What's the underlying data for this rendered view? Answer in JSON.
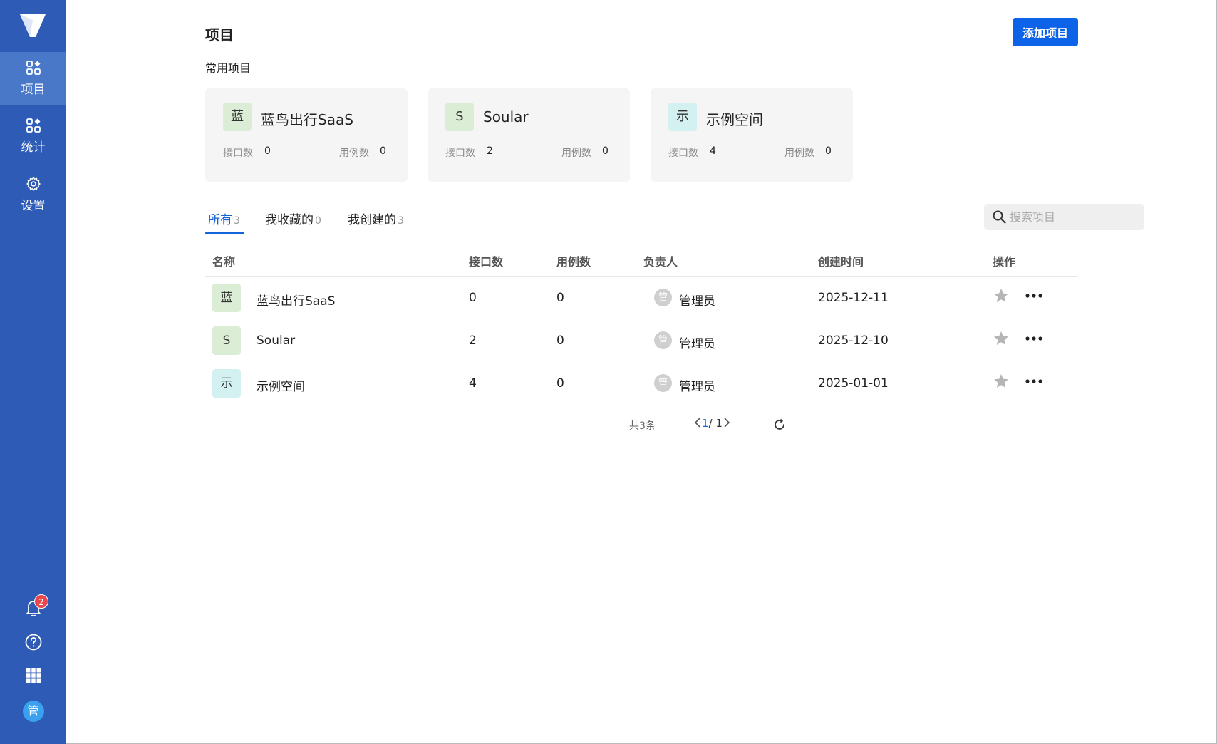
{
  "sidebar": {
    "nav": [
      {
        "label": "项目",
        "icon": "grid-icon",
        "active": true
      },
      {
        "label": "统计",
        "icon": "grid-icon",
        "active": false
      },
      {
        "label": "设置",
        "icon": "gear-icon",
        "active": false
      }
    ],
    "notifications_count": "2",
    "user_avatar_text": "管"
  },
  "header": {
    "title": "项目",
    "add_button": "添加项目"
  },
  "favorites": {
    "label": "常用项目",
    "cards": [
      {
        "mark": "蓝",
        "name": "蓝鸟出行SaaS",
        "api_label": "接口数",
        "api": "0",
        "case_label": "用例数",
        "cases": "0"
      },
      {
        "mark": "S",
        "name": "Soular",
        "api_label": "接口数",
        "api": "2",
        "case_label": "用例数",
        "cases": "0"
      },
      {
        "mark": "示",
        "name": "示例空间",
        "api_label": "接口数",
        "api": "4",
        "case_label": "用例数",
        "cases": "0"
      }
    ]
  },
  "tabs": [
    {
      "label": "所有",
      "count": "3"
    },
    {
      "label": "我收藏的",
      "count": "0"
    },
    {
      "label": "我创建的",
      "count": "3"
    }
  ],
  "search": {
    "placeholder": "搜索项目"
  },
  "table": {
    "columns": [
      "名称",
      "接口数",
      "用例数",
      "负责人",
      "创建时间",
      "操作"
    ],
    "rows": [
      {
        "mark": "蓝",
        "name": "蓝鸟出行SaaS",
        "api": "0",
        "cases": "0",
        "owner_av": "管",
        "owner": "管理员",
        "created": "2025-12-11"
      },
      {
        "mark": "S",
        "name": "Soular",
        "api": "2",
        "cases": "0",
        "owner_av": "管",
        "owner": "管理员",
        "created": "2025-12-10"
      },
      {
        "mark": "示",
        "name": "示例空间",
        "api": "4",
        "cases": "0",
        "owner_av": "管",
        "owner": "管理员",
        "created": "2025-01-01"
      }
    ]
  },
  "pagination": {
    "total": "共3条",
    "current": "1",
    "separator": "/ ",
    "pages": "1"
  },
  "colors": {
    "sidebar": "#2d5bb5",
    "sidebar_active": "#4a78c9",
    "primary": "#0c63e7",
    "tab_active": "#1363d9"
  }
}
